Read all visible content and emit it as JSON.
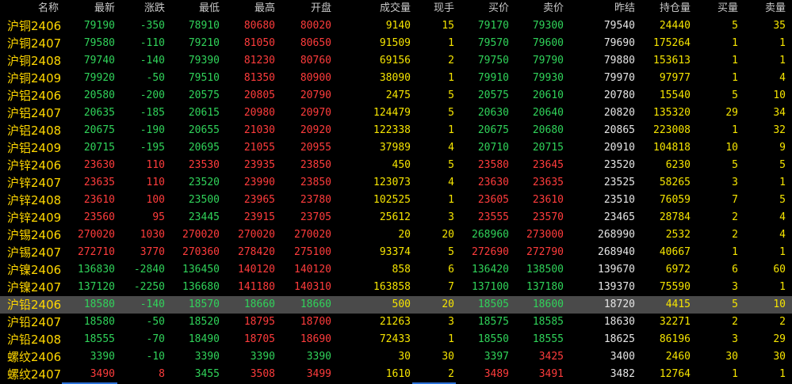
{
  "colors": {
    "up": "#ff3c3c",
    "down": "#30d35a",
    "flat": "#e6e6e6",
    "yellow": "#f5e400",
    "name": "#ffd700",
    "header": "#c8c8c8",
    "selected_bg": "#4a4a4a"
  },
  "columns": [
    "名称",
    "最新",
    "涨跌",
    "最低",
    "最高",
    "开盘",
    "成交量",
    "现手",
    "买价",
    "卖价",
    "昨结",
    "持仓量",
    "买量",
    "卖量"
  ],
  "selected_row": 16,
  "rows": [
    {
      "name": "沪铜2406",
      "latest": "79190",
      "change": "-350",
      "low": "78910",
      "high": "80680",
      "open": "80020",
      "volume": "9140",
      "current": "15",
      "bid": "79170",
      "ask": "79300",
      "settle": "79540",
      "oi": "24440",
      "bidvol": "5",
      "askvol": "35"
    },
    {
      "name": "沪铜2407",
      "latest": "79580",
      "change": "-110",
      "low": "79210",
      "high": "81050",
      "open": "80650",
      "volume": "91509",
      "current": "1",
      "bid": "79570",
      "ask": "79600",
      "settle": "79690",
      "oi": "175264",
      "bidvol": "1",
      "askvol": "1"
    },
    {
      "name": "沪铜2408",
      "latest": "79740",
      "change": "-140",
      "low": "79390",
      "high": "81230",
      "open": "80760",
      "volume": "69156",
      "current": "2",
      "bid": "79750",
      "ask": "79790",
      "settle": "79880",
      "oi": "153613",
      "bidvol": "1",
      "askvol": "1"
    },
    {
      "name": "沪铜2409",
      "latest": "79920",
      "change": "-50",
      "low": "79510",
      "high": "81350",
      "open": "80900",
      "volume": "38090",
      "current": "1",
      "bid": "79910",
      "ask": "79930",
      "settle": "79970",
      "oi": "97977",
      "bidvol": "1",
      "askvol": "4"
    },
    {
      "name": "沪铝2406",
      "latest": "20580",
      "change": "-200",
      "low": "20575",
      "high": "20805",
      "open": "20790",
      "volume": "2475",
      "current": "5",
      "bid": "20575",
      "ask": "20610",
      "settle": "20780",
      "oi": "15540",
      "bidvol": "5",
      "askvol": "10"
    },
    {
      "name": "沪铝2407",
      "latest": "20635",
      "change": "-185",
      "low": "20615",
      "high": "20980",
      "open": "20970",
      "volume": "124479",
      "current": "5",
      "bid": "20630",
      "ask": "20640",
      "settle": "20820",
      "oi": "135320",
      "bidvol": "29",
      "askvol": "34"
    },
    {
      "name": "沪铝2408",
      "latest": "20675",
      "change": "-190",
      "low": "20655",
      "high": "21030",
      "open": "20920",
      "volume": "122338",
      "current": "1",
      "bid": "20675",
      "ask": "20680",
      "settle": "20865",
      "oi": "223008",
      "bidvol": "1",
      "askvol": "32"
    },
    {
      "name": "沪铝2409",
      "latest": "20715",
      "change": "-195",
      "low": "20695",
      "high": "21055",
      "open": "20955",
      "volume": "37989",
      "current": "4",
      "bid": "20710",
      "ask": "20715",
      "settle": "20910",
      "oi": "104818",
      "bidvol": "10",
      "askvol": "9"
    },
    {
      "name": "沪锌2406",
      "latest": "23630",
      "change": "110",
      "low": "23530",
      "high": "23935",
      "open": "23850",
      "volume": "450",
      "current": "5",
      "bid": "23580",
      "ask": "23645",
      "settle": "23520",
      "oi": "6230",
      "bidvol": "5",
      "askvol": "5"
    },
    {
      "name": "沪锌2407",
      "latest": "23635",
      "change": "110",
      "low": "23520",
      "high": "23990",
      "open": "23850",
      "volume": "123073",
      "current": "4",
      "bid": "23630",
      "ask": "23635",
      "settle": "23525",
      "oi": "58265",
      "bidvol": "3",
      "askvol": "1"
    },
    {
      "name": "沪锌2408",
      "latest": "23610",
      "change": "100",
      "low": "23500",
      "high": "23965",
      "open": "23780",
      "volume": "102525",
      "current": "1",
      "bid": "23605",
      "ask": "23610",
      "settle": "23510",
      "oi": "76059",
      "bidvol": "7",
      "askvol": "5"
    },
    {
      "name": "沪锌2409",
      "latest": "23560",
      "change": "95",
      "low": "23445",
      "high": "23915",
      "open": "23705",
      "volume": "25612",
      "current": "3",
      "bid": "23555",
      "ask": "23570",
      "settle": "23465",
      "oi": "28784",
      "bidvol": "2",
      "askvol": "4"
    },
    {
      "name": "沪锡2406",
      "latest": "270020",
      "change": "1030",
      "low": "270020",
      "high": "270020",
      "open": "270020",
      "volume": "20",
      "current": "20",
      "bid": "268960",
      "ask": "273000",
      "settle": "268990",
      "oi": "2532",
      "bidvol": "2",
      "askvol": "4"
    },
    {
      "name": "沪锡2407",
      "latest": "272710",
      "change": "3770",
      "low": "270360",
      "high": "278420",
      "open": "275100",
      "volume": "93374",
      "current": "5",
      "bid": "272690",
      "ask": "272790",
      "settle": "268940",
      "oi": "40667",
      "bidvol": "1",
      "askvol": "1"
    },
    {
      "name": "沪镍2406",
      "latest": "136830",
      "change": "-2840",
      "low": "136450",
      "high": "140120",
      "open": "140120",
      "volume": "858",
      "current": "6",
      "bid": "136420",
      "ask": "138500",
      "settle": "139670",
      "oi": "6972",
      "bidvol": "6",
      "askvol": "60"
    },
    {
      "name": "沪镍2407",
      "latest": "137120",
      "change": "-2250",
      "low": "136680",
      "high": "141180",
      "open": "140310",
      "volume": "163858",
      "current": "7",
      "bid": "137100",
      "ask": "137180",
      "settle": "139370",
      "oi": "75590",
      "bidvol": "3",
      "askvol": "1"
    },
    {
      "name": "沪铅2406",
      "latest": "18580",
      "change": "-140",
      "low": "18570",
      "high": "18660",
      "open": "18660",
      "volume": "500",
      "current": "20",
      "bid": "18505",
      "ask": "18600",
      "settle": "18720",
      "oi": "4415",
      "bidvol": "5",
      "askvol": "10"
    },
    {
      "name": "沪铅2407",
      "latest": "18580",
      "change": "-50",
      "low": "18520",
      "high": "18795",
      "open": "18700",
      "volume": "21263",
      "current": "3",
      "bid": "18575",
      "ask": "18585",
      "settle": "18630",
      "oi": "32271",
      "bidvol": "2",
      "askvol": "2"
    },
    {
      "name": "沪铅2408",
      "latest": "18555",
      "change": "-70",
      "low": "18490",
      "high": "18705",
      "open": "18690",
      "volume": "72433",
      "current": "1",
      "bid": "18550",
      "ask": "18555",
      "settle": "18625",
      "oi": "86196",
      "bidvol": "3",
      "askvol": "29"
    },
    {
      "name": "螺纹2406",
      "latest": "3390",
      "change": "-10",
      "low": "3390",
      "high": "3390",
      "open": "3390",
      "volume": "30",
      "current": "30",
      "bid": "3397",
      "ask": "3425",
      "settle": "3400",
      "oi": "2460",
      "bidvol": "30",
      "askvol": "30"
    },
    {
      "name": "螺纹2407",
      "latest": "3490",
      "change": "8",
      "low": "3455",
      "high": "3508",
      "open": "3499",
      "volume": "1610",
      "current": "2",
      "bid": "3489",
      "ask": "3491",
      "settle": "3482",
      "oi": "12764",
      "bidvol": "1",
      "askvol": "1"
    }
  ]
}
